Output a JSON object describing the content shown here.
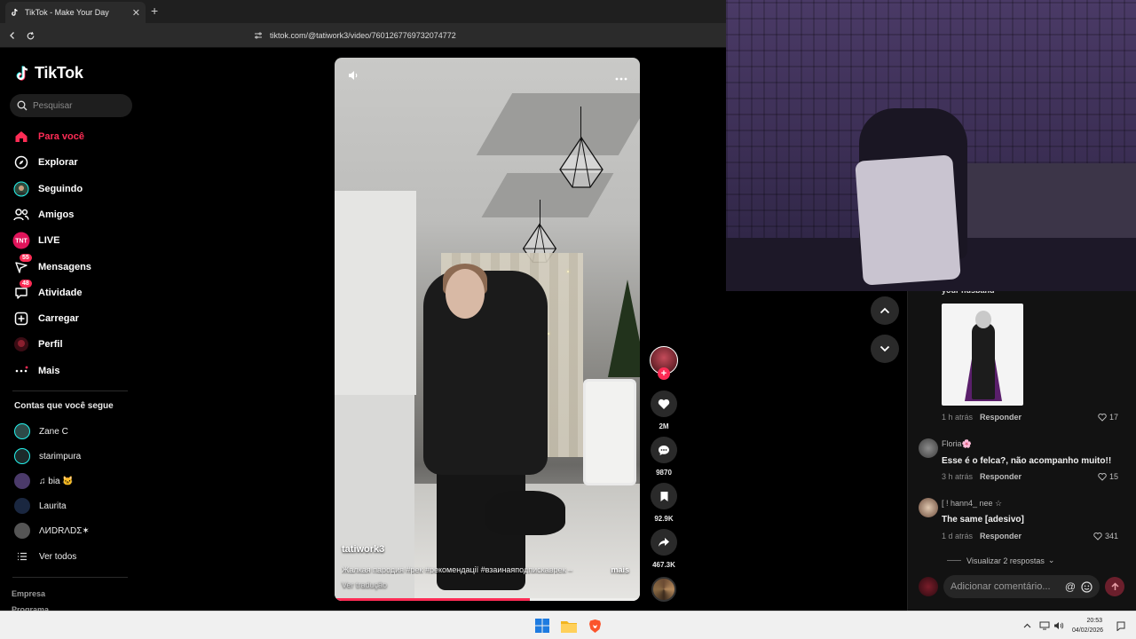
{
  "browser": {
    "tab_title": "TikTok - Make Your Day",
    "url": "tiktok.com/@tatiwork3/video/7601267769732074772"
  },
  "sidebar": {
    "logo": "TikTok",
    "search_placeholder": "Pesquisar",
    "nav": [
      {
        "label": "Para você",
        "icon": "home-icon",
        "active": true
      },
      {
        "label": "Explorar",
        "icon": "compass-icon"
      },
      {
        "label": "Seguindo",
        "icon": "following-avatar-icon"
      },
      {
        "label": "Amigos",
        "icon": "friends-icon"
      },
      {
        "label": "LIVE",
        "icon": "live-icon"
      },
      {
        "label": "Mensagens",
        "icon": "messages-icon",
        "badge": "55"
      },
      {
        "label": "Atividade",
        "icon": "activity-icon",
        "badge": "48"
      },
      {
        "label": "Carregar",
        "icon": "upload-icon"
      },
      {
        "label": "Perfil",
        "icon": "profile-icon"
      },
      {
        "label": "Mais",
        "icon": "more-icon"
      }
    ],
    "following_title": "Contas que você segue",
    "following": [
      {
        "name": "Zane C"
      },
      {
        "name": "starimpura"
      },
      {
        "name": "♫ bia 🐱"
      },
      {
        "name": "Laurita"
      },
      {
        "name": "ΛИDRΛDΣ✶"
      }
    ],
    "see_all": "Ver todos",
    "footer": [
      "Empresa",
      "Programa"
    ]
  },
  "video": {
    "author": "tatiwork3",
    "caption": "Жалкая пародия #рек #рекомендації #взаинаяподпискаврек –",
    "more": "mais",
    "translate": "Ver tradução",
    "progress": 0.64
  },
  "actions": {
    "likes": "2M",
    "comments": "9870",
    "saves": "92.9K",
    "shares": "467.3K"
  },
  "comments": {
    "cut_name": "your husband",
    "items": [
      {
        "meta_time": "1 h atrás",
        "reply": "Responder",
        "likes": "17"
      },
      {
        "user": "Floria🌸",
        "text": "Esse é o felca?, não acompanho muito!!",
        "meta_time": "3 h atrás",
        "reply": "Responder",
        "likes": "15"
      },
      {
        "user": "[ ! hann4_ nee ☆",
        "text": "The same [adesivo]",
        "meta_time": "1 d atrás",
        "reply": "Responder",
        "likes": "341"
      }
    ],
    "view_replies": "Visualizar 2 respostas",
    "input_placeholder": "Adicionar comentário..."
  },
  "taskbar": {
    "time": "20:53",
    "date": "04/02/2026"
  },
  "colors": {
    "accent": "#fe2c55",
    "background": "#000000",
    "panel": "#121212"
  }
}
